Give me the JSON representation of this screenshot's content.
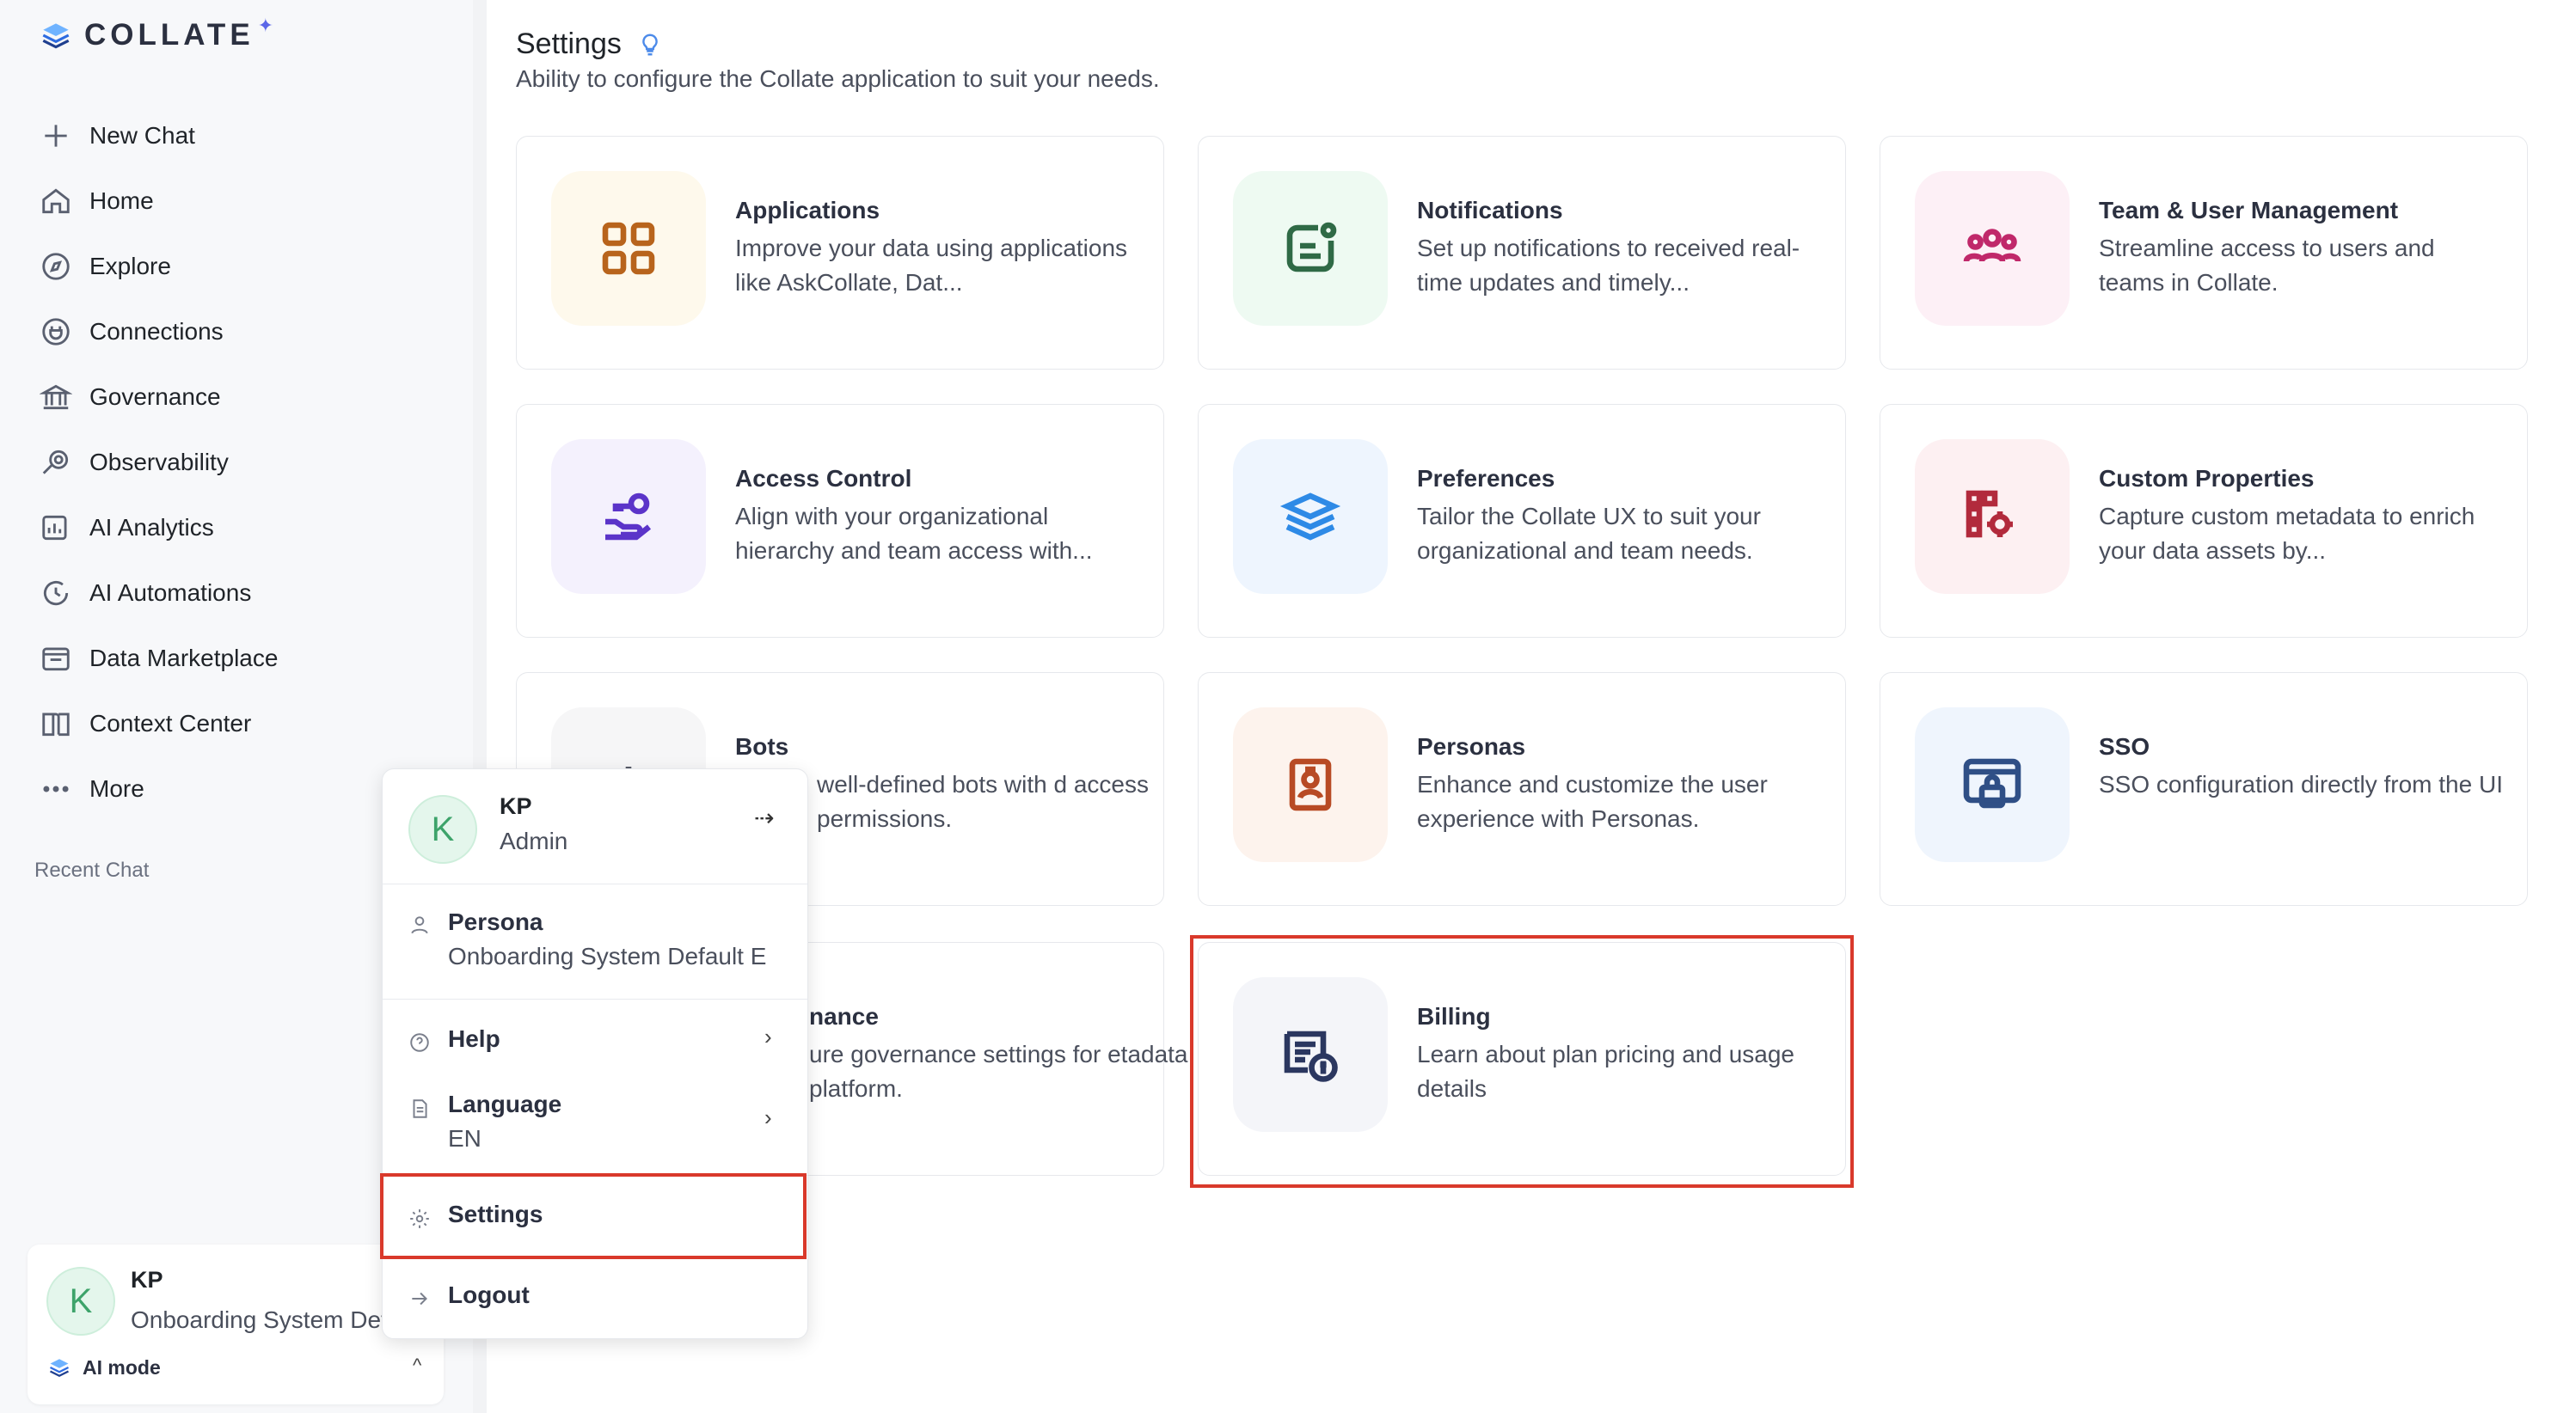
{
  "brand": {
    "name": "COLLATE",
    "spark": "✦"
  },
  "nav": {
    "items": [
      {
        "label": "New Chat",
        "icon": "plus-icon"
      },
      {
        "label": "Home",
        "icon": "home-icon"
      },
      {
        "label": "Explore",
        "icon": "compass-icon"
      },
      {
        "label": "Connections",
        "icon": "plug-icon"
      },
      {
        "label": "Governance",
        "icon": "bank-icon"
      },
      {
        "label": "Observability",
        "icon": "telescope-icon"
      },
      {
        "label": "AI Analytics",
        "icon": "chart-icon"
      },
      {
        "label": "AI Automations",
        "icon": "automation-icon"
      },
      {
        "label": "Data Marketplace",
        "icon": "store-icon"
      },
      {
        "label": "Context Center",
        "icon": "book-icon"
      },
      {
        "label": "More",
        "icon": "more-icon"
      }
    ],
    "recent_chat": "Recent Chat"
  },
  "user_card": {
    "initial": "K",
    "name": "KP",
    "persona": "Onboarding System Default E",
    "ai_mode": "AI mode",
    "chevron": "^"
  },
  "popup": {
    "initial": "K",
    "name": "KP",
    "role": "Admin",
    "arrow": "⇢",
    "persona_label": "Persona",
    "persona_value": "Onboarding System Default E",
    "help_label": "Help",
    "language_label": "Language",
    "language_value": "EN",
    "settings_label": "Settings",
    "logout_label": "Logout",
    "chevron": "›"
  },
  "main": {
    "title": "Settings",
    "description": "Ability to configure the Collate application to suit your needs.",
    "cards": [
      {
        "title": "Applications",
        "desc": "Improve your data using applications like AskCollate, Dat...",
        "icon": "grid-icon",
        "color": "#b8641c",
        "bg": "#fef9ec"
      },
      {
        "title": "Notifications",
        "desc": "Set up notifications to received real-time updates and timely...",
        "icon": "notification-icon",
        "color": "#2f6a46",
        "bg": "#eefaf2"
      },
      {
        "title": "Team & User Management",
        "desc": "Streamline access to users and teams in Collate.",
        "icon": "users-icon",
        "color": "#c0286a",
        "bg": "#fdf0f6"
      },
      {
        "title": "Access Control",
        "desc": "Align with your organizational hierarchy and team access with...",
        "icon": "key-hand-icon",
        "color": "#5b34c9",
        "bg": "#f4f1fd"
      },
      {
        "title": "Preferences",
        "desc": "Tailor the Collate UX to suit your organizational and team needs.",
        "icon": "layers-icon",
        "color": "#2e8ae6",
        "bg": "#eef5fe"
      },
      {
        "title": "Custom Properties",
        "desc": "Capture custom metadata to enrich your data assets by...",
        "icon": "custom-properties-icon",
        "color": "#b22a3c",
        "bg": "#fdf0f2"
      },
      {
        "title": "Bots",
        "desc": "well-defined bots with d access permissions.",
        "icon": "bot-icon",
        "color": "#555a66",
        "bg": "#f6f6f7"
      },
      {
        "title": "Personas",
        "desc": "Enhance and customize the user experience with Personas.",
        "icon": "persona-icon",
        "color": "#b84a24",
        "bg": "#fdf3ed"
      },
      {
        "title": "SSO",
        "desc": "SSO configuration directly from the UI",
        "icon": "sso-lock-icon",
        "color": "#2f4f86",
        "bg": "#eff5fd"
      },
      {
        "title": "nance",
        "desc": "ure governance settings for etadata platform.",
        "icon": "governance-icon",
        "color": "#555a66",
        "bg": "#f6f6f7"
      },
      {
        "title": "Billing",
        "desc": "Learn about plan pricing and usage details",
        "icon": "billing-icon",
        "color": "#2b3760",
        "bg": "#f4f5f9"
      }
    ]
  }
}
